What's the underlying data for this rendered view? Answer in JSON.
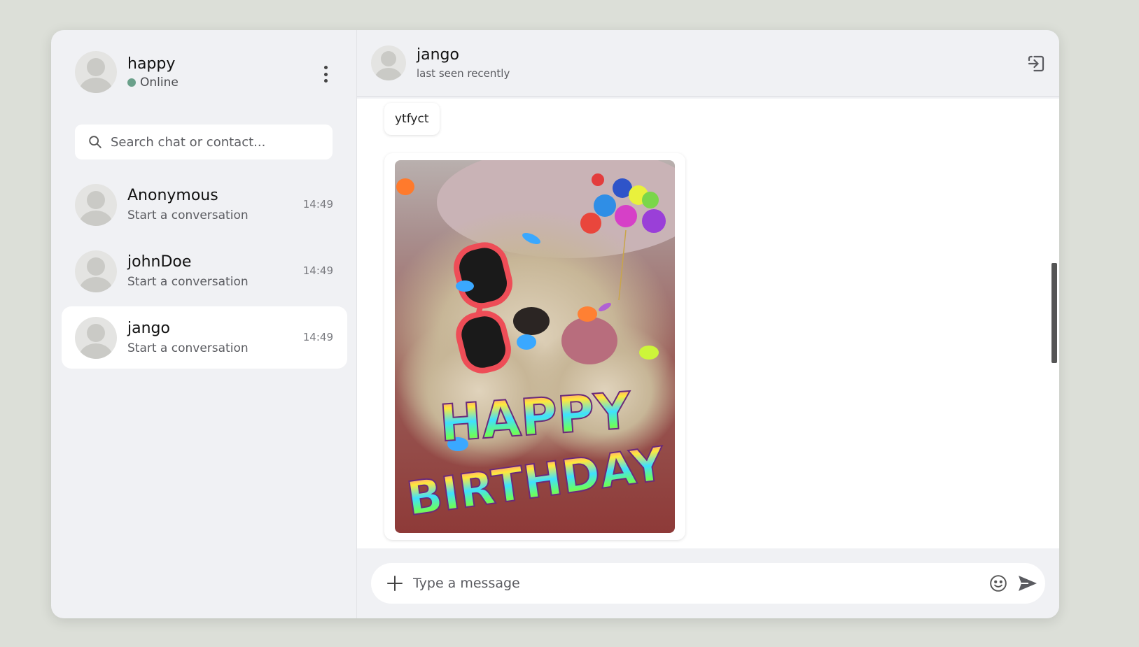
{
  "user": {
    "name": "happy",
    "status": "Online"
  },
  "search": {
    "placeholder": "Search chat or contact..."
  },
  "chats": [
    {
      "name": "Anonymous",
      "preview": "Start a conversation",
      "time": "14:49"
    },
    {
      "name": "johnDoe",
      "preview": "Start a conversation",
      "time": "14:49"
    },
    {
      "name": "jango",
      "preview": "Start a conversation",
      "time": "14:49"
    }
  ],
  "active_chat": {
    "name": "jango",
    "status": "last seen recently"
  },
  "messages": [
    {
      "type": "text",
      "text": "ytfyct"
    },
    {
      "type": "image",
      "caption_art": [
        "HAPPY",
        "BIRTHDAY"
      ]
    }
  ],
  "composer": {
    "placeholder": "Type a message"
  },
  "icons": {
    "menu": "kebab-menu-icon",
    "search": "search-icon",
    "logout": "logout-icon",
    "attach": "plus-icon",
    "emoji": "emoji-icon",
    "send": "send-icon"
  },
  "colors": {
    "online": "#6aa08a",
    "background": "#dcdfd8",
    "panel": "#f0f1f4"
  }
}
